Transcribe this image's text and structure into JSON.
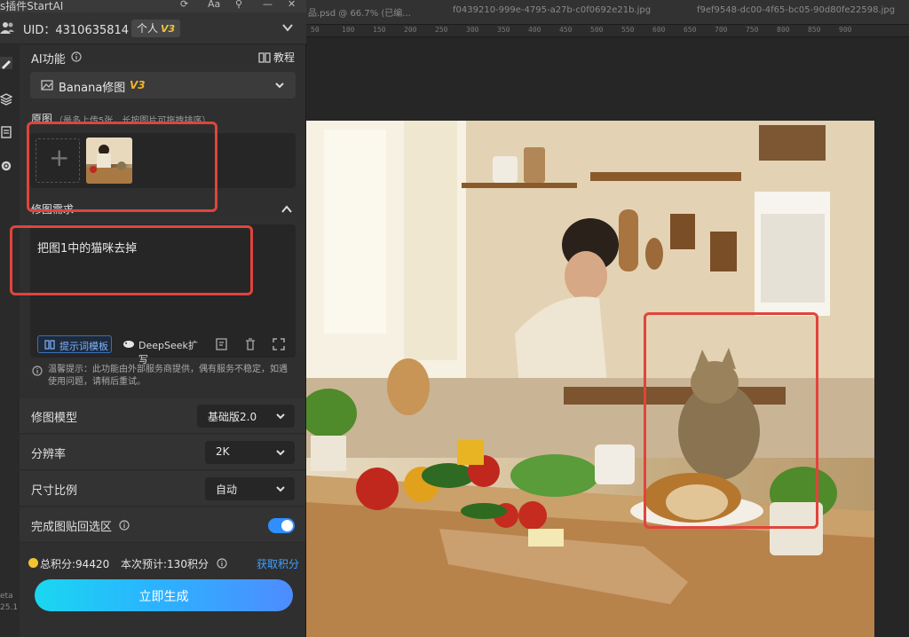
{
  "window": {
    "title": "s插件StartAI",
    "controls": [
      "⟳",
      "Aa",
      "⚲",
      "—",
      "✕"
    ]
  },
  "account": {
    "uid_label": "UID：4310635814",
    "plan": "个人",
    "plan_badge": "V3"
  },
  "ai": {
    "section_label": "AI功能",
    "tutorial": "教程",
    "function_name": "Banana修图",
    "function_version": "V3"
  },
  "images": {
    "label": "原图",
    "hint": "（最多上传5张，长按图片可拖拽排序）",
    "add_symbol": "+"
  },
  "request": {
    "label": "修图需求",
    "value": "把图1中的猫咪去掉",
    "template_button": "提示词模板",
    "deepseek_button": "DeepSeek扩写"
  },
  "notice": "温馨提示：此功能由外部服务商提供，偶有服务不稳定，如遇使用问题，请稍后重试。",
  "settings": {
    "model_label": "修图模型",
    "model_value": "基础版2.0",
    "resolution_label": "分辨率",
    "resolution_value": "2K",
    "ratio_label": "尺寸比例",
    "ratio_value": "自动",
    "paste_label": "完成图贴回选区"
  },
  "points": {
    "total": "总积分:94420",
    "estimate": "本次预计:130积分",
    "get_link": "获取积分"
  },
  "generate_button": "立即生成",
  "version": {
    "line1": "eta",
    "line2": "25.1"
  },
  "ps": {
    "tabs": [
      "品.psd @ 66.7% (已编...",
      "f0439210-999e-4795-a27b-c0f0692e21b.jpg",
      "f9ef9548-dc00-4f65-bc05-90d80fe22598.jpg"
    ],
    "ruler": [
      "50",
      "100",
      "150",
      "200",
      "250",
      "300",
      "350",
      "400",
      "450",
      "500",
      "550",
      "600",
      "650",
      "700",
      "750",
      "800",
      "850",
      "900"
    ]
  },
  "colors": {
    "accent": "#2f8fff",
    "highlight": "#e0443c",
    "badge": "#f0c23c"
  }
}
